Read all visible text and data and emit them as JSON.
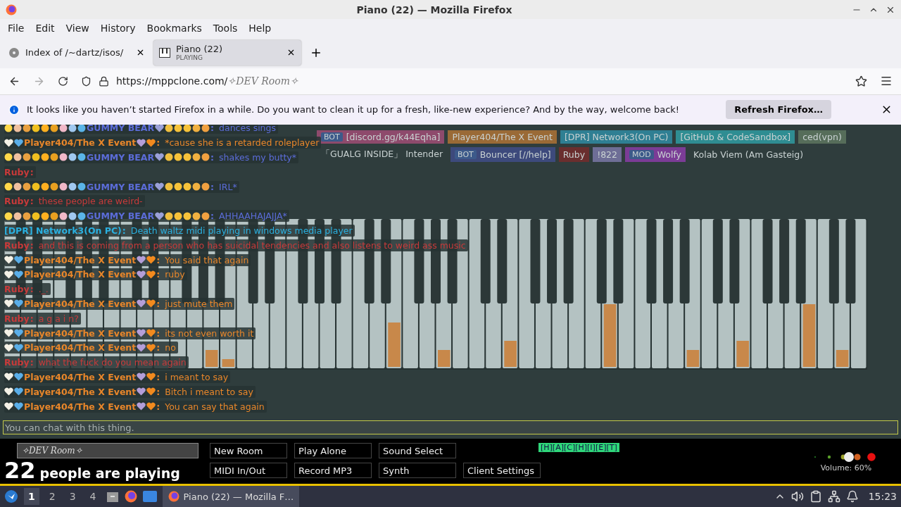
{
  "window": {
    "title": "Piano (22) — Mozilla Firefox"
  },
  "menu": [
    "File",
    "Edit",
    "View",
    "History",
    "Bookmarks",
    "Tools",
    "Help"
  ],
  "tabs": [
    {
      "title": "Index of /~dartz/isos/",
      "selected": false
    },
    {
      "title": "Piano (22)",
      "subtitle": "PLAYING",
      "selected": true
    }
  ],
  "address": {
    "base": "https://mppclone.com/",
    "path": "✧DEV Room✧"
  },
  "notification": {
    "text": "It looks like you haven’t started Firefox in a while. Do you want to clean it up for a fresh, like-new experience? And by the way, welcome back!",
    "button": "Refresh Firefox…"
  },
  "players": [
    {
      "badge": "BOT",
      "label": "[discord.gg/k44Eqha]",
      "color": "#8e4a6c"
    },
    {
      "label": "Player404/The X Event",
      "color": "#9a6a36"
    },
    {
      "label": "[DPR] Network3(On PC)",
      "color": "#2f7f93"
    },
    {
      "label": "[GitHub & CodeSandbox]",
      "color": "#2f8d92"
    },
    {
      "label": "ced(vpn)",
      "color": "#566d5a"
    },
    {
      "label": "「GUALG INSIDE」 Intender",
      "color": "#2f3d3d"
    },
    {
      "badge": "BOT",
      "label": "Bouncer [//help]",
      "color": "#3d4a7c"
    },
    {
      "label": "Ruby",
      "color": "#6a2e2e"
    },
    {
      "label": "!822",
      "color": "#6e6e96"
    },
    {
      "badge": "MOD",
      "label": "Wolfy",
      "color": "#7b3c96"
    },
    {
      "label": "Kolab Viem (Am Gasteig)",
      "color": "#2f3d3d"
    }
  ],
  "chat": [
    {
      "kind": "gummy",
      "author": "GUMMY BEAR",
      "punct": ":",
      "text": "dances sings"
    },
    {
      "kind": "player404",
      "author": "Player404/The X Event",
      "punct": ":",
      "text": "*cause she is a retarded roleplayer"
    },
    {
      "kind": "gummy",
      "author": "GUMMY BEAR",
      "punct": ":",
      "text": "shakes my butty*"
    },
    {
      "kind": "ruby",
      "author": "Ruby",
      "punct": ":"
    },
    {
      "kind": "gummy",
      "author": "GUMMY BEAR",
      "punct": ":",
      "text": "IRL*"
    },
    {
      "kind": "ruby",
      "author": "Ruby",
      "punct": ":",
      "text": "these people are weird-"
    },
    {
      "kind": "gummy",
      "author": "GUMMY BEAR",
      "punct": ":",
      "text": "AHHAAHAJAJJA*"
    },
    {
      "kind": "dpr",
      "author": "[DPR] Network3(On PC)",
      "punct": ":",
      "text": "Death waltz midi playing in windows media player"
    },
    {
      "kind": "ruby",
      "author": "Ruby",
      "punct": ":",
      "text": "and this is coming from a person who has suicidal tendencies and also listens to weird ass music"
    },
    {
      "kind": "player404",
      "author": "Player404/The X Event",
      "punct": ":",
      "text": "You said that again"
    },
    {
      "kind": "player404",
      "author": "Player404/The X Event",
      "punct": ":",
      "text": "ruby"
    },
    {
      "kind": "ruby",
      "author": "Ruby",
      "punct": ":",
      "text": "._."
    },
    {
      "kind": "player404",
      "author": "Player404/The X Event",
      "punct": ":",
      "text": "just mute them"
    },
    {
      "kind": "ruby",
      "author": "Ruby",
      "punct": ":",
      "text": "a g a i n?"
    },
    {
      "kind": "player404",
      "author": "Player404/The X Event",
      "punct": ":",
      "text": "its not even worth it"
    },
    {
      "kind": "player404",
      "author": "Player404/The X Event",
      "punct": ":",
      "text": "no"
    },
    {
      "kind": "ruby",
      "author": "Ruby",
      "punct": ":",
      "text": "what the fuck do you mean again"
    },
    {
      "kind": "player404",
      "author": "Player404/The X Event",
      "punct": ":",
      "text": "i meant to say"
    },
    {
      "kind": "player404",
      "author": "Player404/The X Event",
      "punct": ":",
      "text": "Bitch i meant to say"
    },
    {
      "kind": "player404",
      "author": "Player404/The X Event",
      "punct": ":",
      "text": "You can say that again"
    }
  ],
  "chat_input": {
    "placeholder": "You can chat with this thing."
  },
  "room": {
    "name": "✧DEV Room✧",
    "count": "22",
    "count_label": "people are playing"
  },
  "buttons": [
    [
      "New Room",
      "MIDI In/Out"
    ],
    [
      "Play Alone",
      "Record MP3"
    ],
    [
      "Sound Select",
      "Synth"
    ],
    [
      "Client Settings"
    ]
  ],
  "cursor_tags": [
    {
      "label": "[H][A][C][H][I][E][T]",
      "color": "#2fd77a"
    }
  ],
  "volume": {
    "label": "Volume: 60%"
  },
  "taskbar": {
    "workspaces": [
      {
        "label": "1",
        "selected": true
      },
      {
        "label": "2",
        "selected": false
      },
      {
        "label": "3",
        "selected": false
      },
      {
        "label": "4",
        "selected": false
      }
    ],
    "task": "Piano (22) — Mozilla F…",
    "clock": "15:23"
  }
}
